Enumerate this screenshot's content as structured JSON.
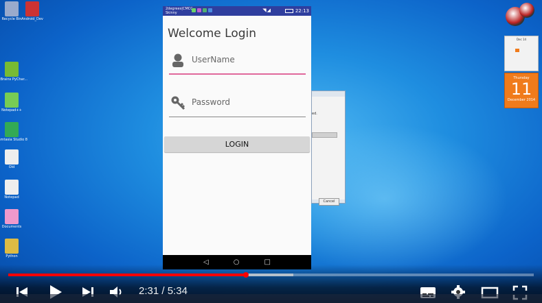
{
  "desktop": {
    "icons": [
      {
        "label": "Recycle Bin",
        "color": "#9ac"
      },
      {
        "label": "Android_Dev",
        "color": "#c33"
      },
      {
        "label": "JetBrains PyChar...",
        "color": "#7b3"
      },
      {
        "label": "Notepad++",
        "color": "#7c5"
      },
      {
        "label": "Camtasia Studio 8",
        "color": "#3a5"
      },
      {
        "label": "Old",
        "color": "#eee"
      },
      {
        "label": "Notepad",
        "color": "#eee"
      },
      {
        "label": "Documents",
        "color": "#e9c"
      },
      {
        "label": "Python",
        "color": "#db4"
      }
    ]
  },
  "phone": {
    "status": {
      "carrier": "2degrees|CMCC Skinny",
      "time": "22:13"
    },
    "app_title": "Welcome Login",
    "username_placeholder": "UserName",
    "password_placeholder": "Password",
    "login_label": "LOGIN",
    "accent": "#e0679b",
    "status_color": "#2f3e9e"
  },
  "dialog": {
    "text": "ed.",
    "cancel_label": "Cancel"
  },
  "calendar": {
    "month_header": "Dec 14",
    "weekday": "Thursday",
    "day": "11",
    "month_year": "December 2014"
  },
  "player": {
    "current_time": "2:31",
    "separator": "/",
    "duration": "5:34",
    "played_fraction": 0.452,
    "buffered_fraction": 0.543,
    "progress_color": "#ff0000"
  }
}
